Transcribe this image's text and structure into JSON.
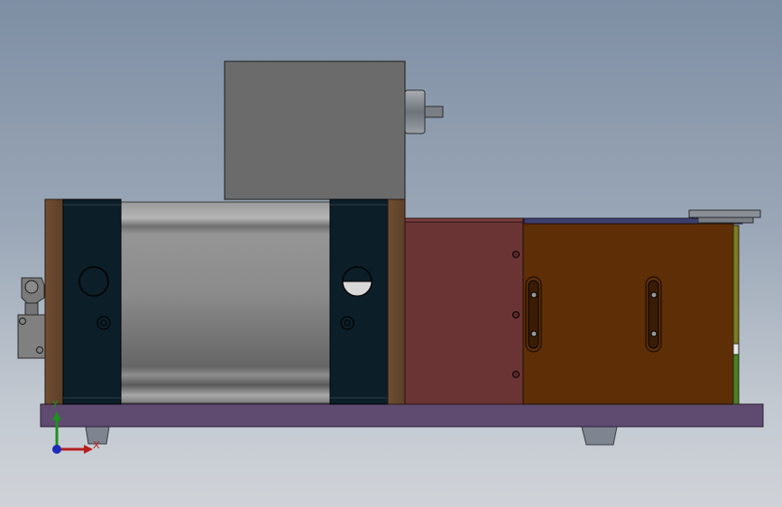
{
  "viewport": {
    "background_top": "#7e8ea3",
    "background_bottom": "#cfd3d8"
  },
  "colors": {
    "base_plate": "#5f4a70",
    "feet": "#7e8590",
    "motor_housing": "#6b6b6b",
    "shaft": "#8e939a",
    "end_block": "#0c1e28",
    "flange": "#6b4a2f",
    "cylinder": "#8c8c8c",
    "red_block": "#6b3434",
    "orange_block": "#5e2f07",
    "top_strip": "#3e3f6e",
    "green_strip": "#4e7e28",
    "switch_body": "#808080"
  },
  "triad": {
    "y_label": "Y",
    "x_label": "X",
    "y_color": "#1e8f1e",
    "x_color": "#b81e1e",
    "z_color": "#1e2ab8"
  }
}
